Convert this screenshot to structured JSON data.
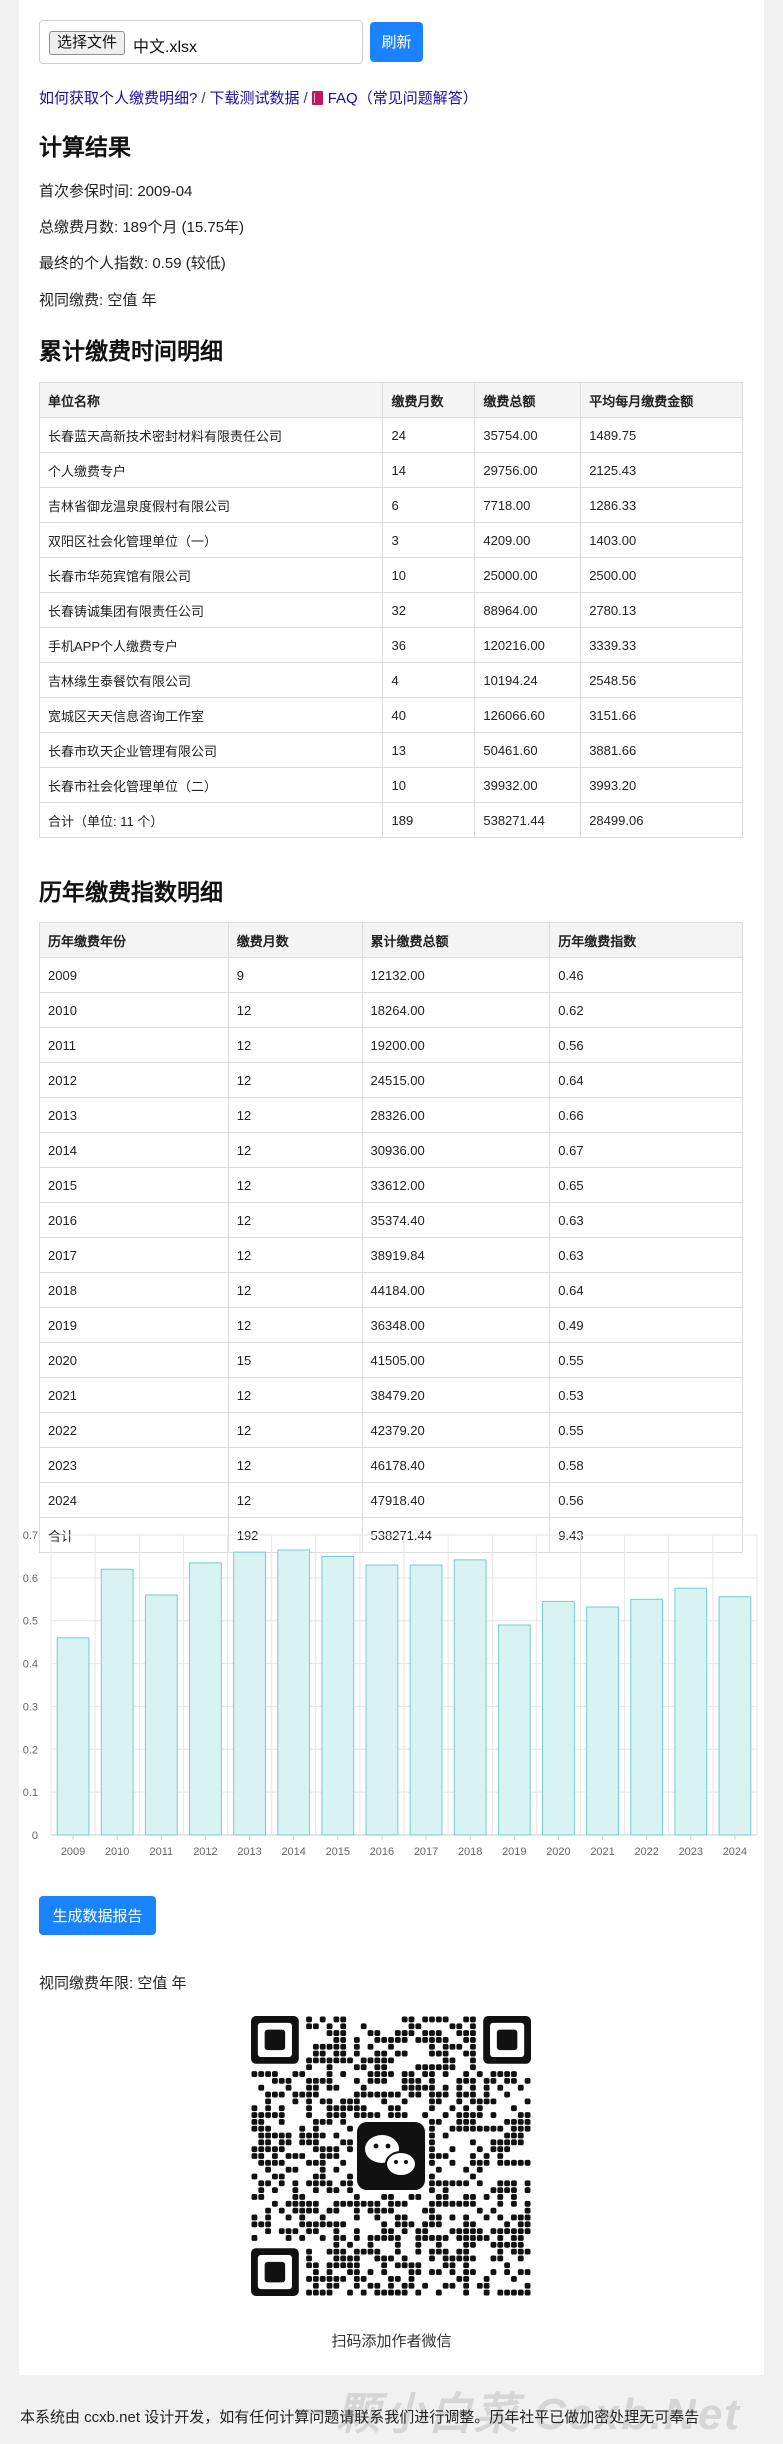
{
  "upload": {
    "choose_file_label": "选择文件",
    "file_name": "中文.xlsx",
    "refresh_label": "刷新"
  },
  "links": {
    "how_to": "如何获取个人缴费明细?",
    "download": "下载测试数据",
    "faq": "FAQ（常见问题解答）",
    "separator": "/"
  },
  "result": {
    "title": "计算结果",
    "first_insured": "首次参保时间: 2009-04",
    "total_months": "总缴费月数: 189个月 (15.75年)",
    "final_index": "最终的个人指数: 0.59 (较低)",
    "deemed": "视同缴费: 空值 年"
  },
  "cumulative": {
    "title": "累计缴费时间明细",
    "headers": [
      "单位名称",
      "缴费月数",
      "缴费总额",
      "平均每月缴费金额"
    ],
    "rows": [
      [
        "长春蓝天高新技术密封材料有限责任公司",
        "24",
        "35754.00",
        "1489.75"
      ],
      [
        "个人缴费专户",
        "14",
        "29756.00",
        "2125.43"
      ],
      [
        "吉林省御龙温泉度假村有限公司",
        "6",
        "7718.00",
        "1286.33"
      ],
      [
        "双阳区社会化管理单位（一）",
        "3",
        "4209.00",
        "1403.00"
      ],
      [
        "长春市华苑宾馆有限公司",
        "10",
        "25000.00",
        "2500.00"
      ],
      [
        "长春铸诚集团有限责任公司",
        "32",
        "88964.00",
        "2780.13"
      ],
      [
        "手机APP个人缴费专户",
        "36",
        "120216.00",
        "3339.33"
      ],
      [
        "吉林缘生泰餐饮有限公司",
        "4",
        "10194.24",
        "2548.56"
      ],
      [
        "宽城区天天信息咨询工作室",
        "40",
        "126066.60",
        "3151.66"
      ],
      [
        "长春市玖天企业管理有限公司",
        "13",
        "50461.60",
        "3881.66"
      ],
      [
        "长春市社会化管理单位（二）",
        "10",
        "39932.00",
        "3993.20"
      ],
      [
        "合计（单位: 11 个）",
        "189",
        "538271.44",
        "28499.06"
      ]
    ]
  },
  "yearly": {
    "title": "历年缴费指数明细",
    "headers": [
      "历年缴费年份",
      "缴费月数",
      "累计缴费总额",
      "历年缴费指数"
    ],
    "rows": [
      [
        "2009",
        "9",
        "12132.00",
        "0.46"
      ],
      [
        "2010",
        "12",
        "18264.00",
        "0.62"
      ],
      [
        "2011",
        "12",
        "19200.00",
        "0.56"
      ],
      [
        "2012",
        "12",
        "24515.00",
        "0.64"
      ],
      [
        "2013",
        "12",
        "28326.00",
        "0.66"
      ],
      [
        "2014",
        "12",
        "30936.00",
        "0.67"
      ],
      [
        "2015",
        "12",
        "33612.00",
        "0.65"
      ],
      [
        "2016",
        "12",
        "35374.40",
        "0.63"
      ],
      [
        "2017",
        "12",
        "38919.84",
        "0.63"
      ],
      [
        "2018",
        "12",
        "44184.00",
        "0.64"
      ],
      [
        "2019",
        "12",
        "36348.00",
        "0.49"
      ],
      [
        "2020",
        "15",
        "41505.00",
        "0.55"
      ],
      [
        "2021",
        "12",
        "38479.20",
        "0.53"
      ],
      [
        "2022",
        "12",
        "42379.20",
        "0.55"
      ],
      [
        "2023",
        "12",
        "46178.40",
        "0.58"
      ],
      [
        "2024",
        "12",
        "47918.40",
        "0.56"
      ],
      [
        "合计",
        "192",
        "538271.44",
        "9.43"
      ]
    ]
  },
  "chart_data": {
    "type": "bar",
    "categories": [
      "2009",
      "2010",
      "2011",
      "2012",
      "2013",
      "2014",
      "2015",
      "2016",
      "2017",
      "2018",
      "2019",
      "2020",
      "2021",
      "2022",
      "2023",
      "2024"
    ],
    "values": [
      0.46,
      0.62,
      0.56,
      0.635,
      0.66,
      0.665,
      0.65,
      0.63,
      0.63,
      0.642,
      0.49,
      0.545,
      0.532,
      0.55,
      0.576,
      0.556
    ],
    "yticks": [
      "0",
      "0.1",
      "0.2",
      "0.3",
      "0.4",
      "0.5",
      "0.6",
      "0.7"
    ],
    "ylim": [
      0,
      0.7
    ],
    "grid": true,
    "bar_color": "#d9f2f2",
    "bar_border": "#6fcfcf"
  },
  "report_button": "生成数据报告",
  "deemed_years": "视同缴费年限: 空值 年",
  "qr_caption": "扫码添加作者微信",
  "footer": "本系统由 ccxb.net 设计开发，如有任何计算问题请联系我们进行调整。历年社平已做加密处理无可奉告",
  "watermark": "一颗小白菜 Ccxb.Net",
  "colors": {
    "accent": "#1a83ff",
    "link": "#1a0dab"
  }
}
